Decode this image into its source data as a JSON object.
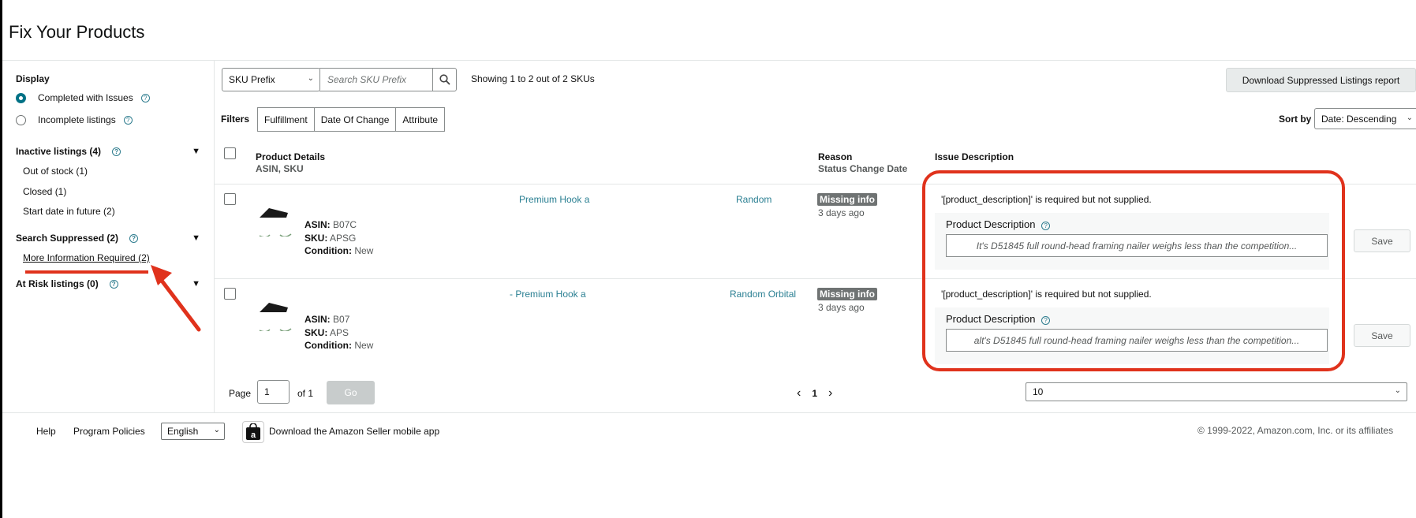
{
  "page": {
    "title": "Fix Your Products"
  },
  "sidebar": {
    "display_heading": "Display",
    "radios": [
      {
        "label": "Completed with Issues",
        "checked": true
      },
      {
        "label": "Incomplete listings",
        "checked": false
      }
    ],
    "groups": [
      {
        "label": "Inactive listings (4)",
        "items": [
          "Out of stock (1)",
          "Closed (1)",
          "Start date in future (2)"
        ]
      },
      {
        "label": "Search Suppressed (2)",
        "items": [
          "More Information Required (2)"
        ]
      },
      {
        "label": "At Risk listings (0)",
        "items": []
      }
    ],
    "help_glyph": "?",
    "collapse_glyph": "▼"
  },
  "toolbar": {
    "sku_select": "SKU Prefix",
    "search_placeholder": "Search SKU Prefix",
    "showing": "Showing 1 to 2 out of 2 SKUs",
    "download_button": "Download Suppressed Listings report",
    "filters_label": "Filters",
    "filters": [
      "Fulfillment",
      "Date Of Change",
      "Attribute"
    ],
    "sort_label": "Sort by",
    "sort_value": "Date: Descending"
  },
  "table": {
    "headers": {
      "product_details": "Product Details",
      "product_details_sub": "ASIN, SKU",
      "reason": "Reason",
      "reason_sub": "Status Change Date",
      "issue_description": "Issue Description"
    },
    "rows": [
      {
        "asin_label": "ASIN:",
        "asin": "B07C",
        "sku_label": "SKU:",
        "sku": "APSG",
        "condition_label": "Condition:",
        "condition": "New",
        "title_part_1": "Premium Hook a",
        "title_part_2": "Random",
        "badge": "Missing info",
        "days": "3 days ago",
        "issue": "'[product_description]' is required but not supplied.",
        "field_label": "Product Description",
        "field_value": "It's D51845 full round-head framing nailer weighs less than the competition...",
        "save": "Save"
      },
      {
        "asin_label": "ASIN:",
        "asin": "B07",
        "sku_label": "SKU:",
        "sku": "APS",
        "condition_label": "Condition:",
        "condition": "New",
        "title_part_1": "- Premium Hook a",
        "title_part_2": "Random Orbital",
        "badge": "Missing info",
        "days": "3 days ago",
        "issue": "'[product_description]' is required but not supplied.",
        "field_label": "Product Description",
        "field_value": "alt's D51845 full round-head framing nailer weighs less than the competition...",
        "save": "Save"
      }
    ]
  },
  "pagination": {
    "page_label": "Page",
    "page_value": "1",
    "of_label": "of 1",
    "go": "Go",
    "prev": "‹",
    "current": "1",
    "next": "›",
    "per_page": "10"
  },
  "footer": {
    "help": "Help",
    "policies": "Program Policies",
    "language": "English",
    "app_text": "Download the Amazon Seller mobile app",
    "app_icon_glyph": "a",
    "copyright": "© 1999-2022, Amazon.com, Inc. or its affiliates"
  },
  "colors": {
    "annotation_red": "#e0321c",
    "link_teal": "#2a7f92",
    "badge_gray": "#6f7373"
  }
}
